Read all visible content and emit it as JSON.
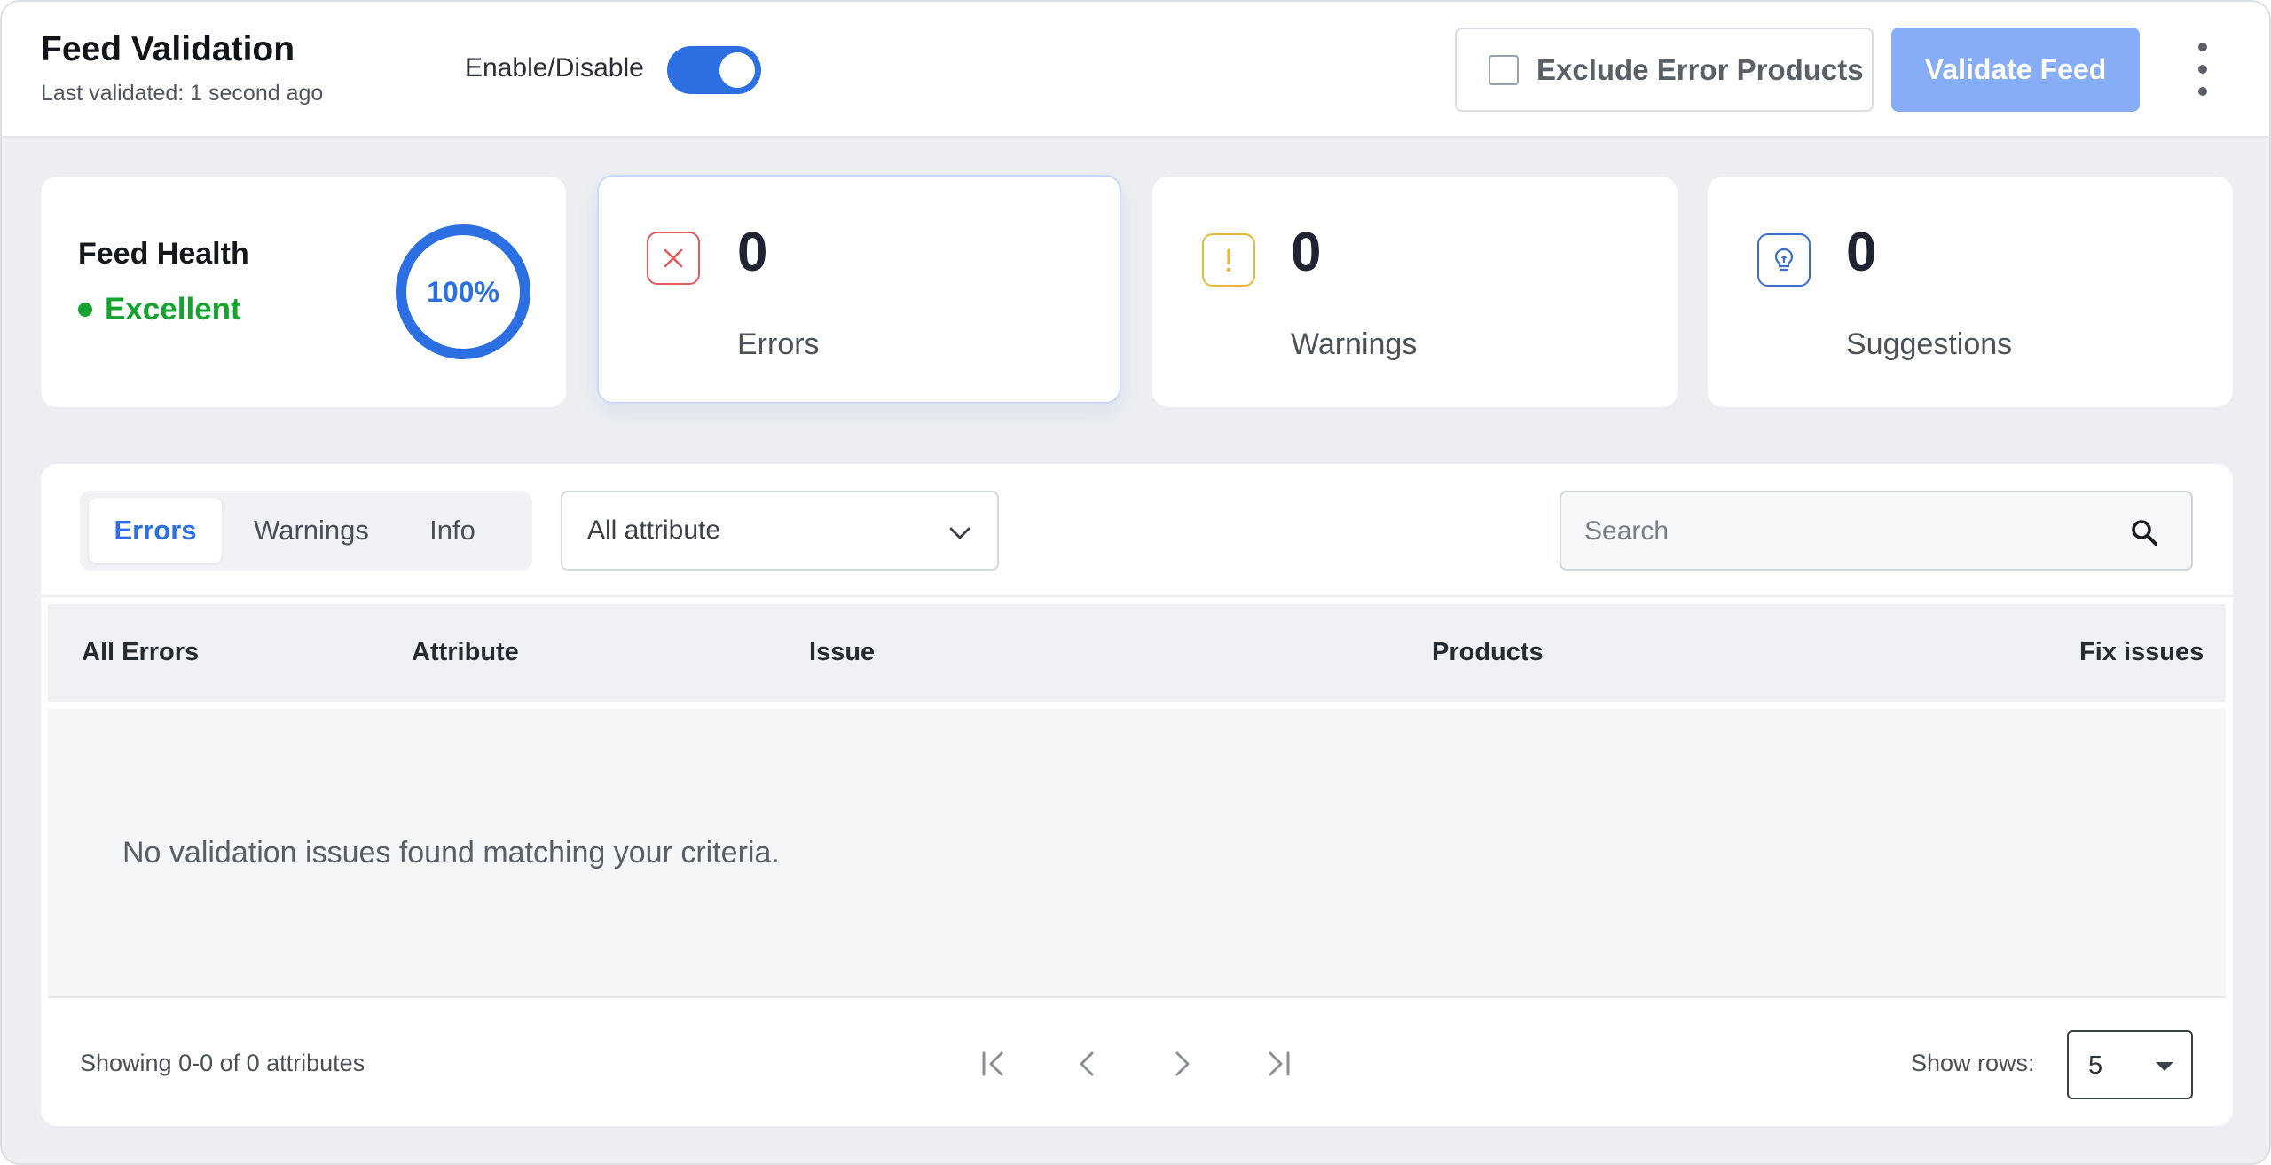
{
  "header": {
    "title": "Feed Validation",
    "subtitle": "Last validated: 1 second ago",
    "toggle_label": "Enable/Disable",
    "toggle_on": true,
    "exclude_label": "Exclude Error Products",
    "exclude_checked": false,
    "validate_label": "Validate Feed"
  },
  "summary": {
    "health": {
      "title": "Feed Health",
      "status": "Excellent",
      "percent_label": "100%",
      "percent": 100
    },
    "errors": {
      "count": "0",
      "label": "Errors"
    },
    "warnings": {
      "count": "0",
      "label": "Warnings"
    },
    "suggestions": {
      "count": "0",
      "label": "Suggestions"
    }
  },
  "panel": {
    "tabs": [
      {
        "label": "Errors",
        "active": true
      },
      {
        "label": "Warnings",
        "active": false
      },
      {
        "label": "Info",
        "active": false
      }
    ],
    "attribute_filter": "All attribute",
    "search_placeholder": "Search",
    "columns": [
      "All Errors",
      "Attribute",
      "Issue",
      "Products",
      "Fix issues"
    ],
    "empty_message": "No validation issues found matching your criteria.",
    "showing": "Showing 0-0 of 0 attributes",
    "rows_label": "Show rows:",
    "rows_value": "5"
  },
  "colors": {
    "accent": "#2b6fe3",
    "success": "#15a32f",
    "error": "#e25b5b",
    "warning": "#e9b73a",
    "validate_button": "#86adf6"
  },
  "icons": {
    "errors": "close-x-icon",
    "warnings": "exclamation-icon",
    "suggestions": "lightbulb-icon",
    "search": "search-icon",
    "menu": "kebab-menu-icon"
  }
}
